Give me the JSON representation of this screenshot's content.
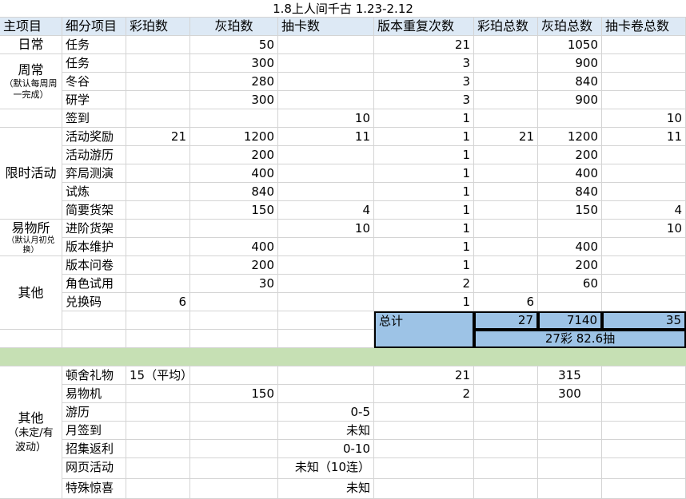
{
  "title": "1.8上人间千古 1.23-2.12",
  "headers": [
    "主项目",
    "细分项目",
    "彩珀数",
    "灰珀数",
    "抽卡数",
    "版本重复次数",
    "彩珀总数",
    "灰珀总数",
    "抽卡卷总数"
  ],
  "groups": {
    "daily": "日常",
    "weekly": {
      "title": "周常",
      "note": "（默认每周周一完成）"
    },
    "limited": "限时活动",
    "shop": {
      "title": "易物所",
      "note": "（默认月初兑换）"
    },
    "other": "其他",
    "other2": {
      "title": "其他",
      "note": "（未定/有波动）"
    }
  },
  "rows": [
    {
      "sub": "任务",
      "cai": "",
      "hui": "50",
      "chou": "",
      "rep": "21",
      "cai_t": "",
      "hui_t": "1050",
      "chou_t": ""
    },
    {
      "sub": "任务",
      "cai": "",
      "hui": "300",
      "chou": "",
      "rep": "3",
      "cai_t": "",
      "hui_t": "900",
      "chou_t": ""
    },
    {
      "sub": "冬谷",
      "cai": "",
      "hui": "280",
      "chou": "",
      "rep": "3",
      "cai_t": "",
      "hui_t": "840",
      "chou_t": ""
    },
    {
      "sub": "研学",
      "cai": "",
      "hui": "300",
      "chou": "",
      "rep": "3",
      "cai_t": "",
      "hui_t": "900",
      "chou_t": ""
    },
    {
      "sub": "签到",
      "cai": "",
      "hui": "",
      "chou": "10",
      "rep": "1",
      "cai_t": "",
      "hui_t": "",
      "chou_t": "10"
    },
    {
      "sub": "活动奖励",
      "cai": "21",
      "hui": "1200",
      "chou": "11",
      "rep": "1",
      "cai_t": "21",
      "hui_t": "1200",
      "chou_t": "11"
    },
    {
      "sub": "活动游历",
      "cai": "",
      "hui": "200",
      "chou": "",
      "rep": "1",
      "cai_t": "",
      "hui_t": "200",
      "chou_t": ""
    },
    {
      "sub": "弈局测演",
      "cai": "",
      "hui": "400",
      "chou": "",
      "rep": "1",
      "cai_t": "",
      "hui_t": "400",
      "chou_t": ""
    },
    {
      "sub": "试炼",
      "cai": "",
      "hui": "840",
      "chou": "",
      "rep": "1",
      "cai_t": "",
      "hui_t": "840",
      "chou_t": ""
    },
    {
      "sub": "简要货架",
      "cai": "",
      "hui": "150",
      "chou": "4",
      "rep": "1",
      "cai_t": "",
      "hui_t": "150",
      "chou_t": "4"
    },
    {
      "sub": "进阶货架",
      "cai": "",
      "hui": "",
      "chou": "10",
      "rep": "1",
      "cai_t": "",
      "hui_t": "",
      "chou_t": "10"
    },
    {
      "sub": "版本维护",
      "cai": "",
      "hui": "400",
      "chou": "",
      "rep": "1",
      "cai_t": "",
      "hui_t": "400",
      "chou_t": ""
    },
    {
      "sub": "版本问卷",
      "cai": "",
      "hui": "200",
      "chou": "",
      "rep": "1",
      "cai_t": "",
      "hui_t": "200",
      "chou_t": ""
    },
    {
      "sub": "角色试用",
      "cai": "",
      "hui": "30",
      "chou": "",
      "rep": "2",
      "cai_t": "",
      "hui_t": "60",
      "chou_t": ""
    },
    {
      "sub": "兑换码",
      "cai": "6",
      "hui": "",
      "chou": "",
      "rep": "1",
      "cai_t": "6",
      "hui_t": "",
      "chou_t": ""
    }
  ],
  "total": {
    "label": "总计",
    "cai": "27",
    "hui": "7140",
    "chou": "35",
    "summary": "27彩 82.6抽"
  },
  "rows2": [
    {
      "sub": "顿舍礼物",
      "cai": "15（平均）",
      "hui": "",
      "chou": "",
      "rep": "21",
      "cai_t": "",
      "hui_t": "315",
      "chou_t": ""
    },
    {
      "sub": "易物机",
      "cai": "",
      "hui": "150",
      "chou": "",
      "rep": "2",
      "cai_t": "",
      "hui_t": "300",
      "chou_t": ""
    },
    {
      "sub": "游历",
      "cai": "",
      "hui": "",
      "chou": "0-5",
      "rep": "",
      "cai_t": "",
      "hui_t": "",
      "chou_t": ""
    },
    {
      "sub": "月签到",
      "cai": "",
      "hui": "",
      "chou": "未知",
      "rep": "",
      "cai_t": "",
      "hui_t": "",
      "chou_t": ""
    },
    {
      "sub": "招集返利",
      "cai": "",
      "hui": "",
      "chou": "0-10",
      "rep": "",
      "cai_t": "",
      "hui_t": "",
      "chou_t": ""
    },
    {
      "sub": "网页活动",
      "cai": "",
      "hui": "",
      "chou": "未知（10连）",
      "rep": "",
      "cai_t": "",
      "hui_t": "",
      "chou_t": ""
    },
    {
      "sub": "特殊惊喜",
      "cai": "",
      "hui": "",
      "chou": "未知",
      "rep": "",
      "cai_t": "",
      "hui_t": "",
      "chou_t": ""
    }
  ]
}
